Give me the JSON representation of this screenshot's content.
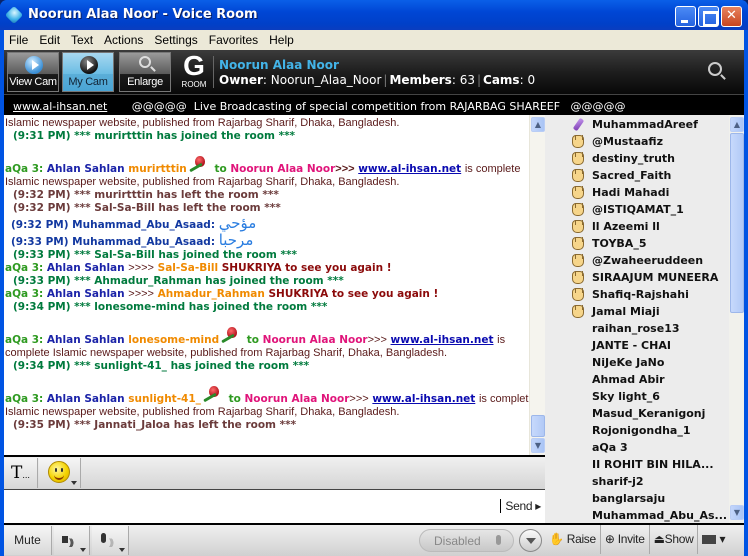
{
  "window": {
    "title": "Noorun Alaa Noor - Voice Room"
  },
  "menu": [
    "File",
    "Edit",
    "Text",
    "Actions",
    "Settings",
    "Favorites",
    "Help"
  ],
  "toolbar": {
    "view_cam": "View Cam",
    "my_cam": "My Cam",
    "enlarge": "Enlarge",
    "room_letter": "G",
    "room_label": "ROOM",
    "room_name": "Noorun Alaa Noor",
    "owner_label": "Owner",
    "owner": "Noorun_Alaa_Noor",
    "members_label": "Members",
    "members": "63",
    "cams_label": "Cams",
    "cams": "0"
  },
  "ticker": {
    "link": "www.al-ihsan.net",
    "text": "@@@@@  Live Broadcasting of special competition from RAJARBAG SHAREEF   @@@@@"
  },
  "chat": {
    "desc": "Islamic newspaper website, published from Rajarbag Sharif, Dhaka, Bangladesh.",
    "desc_wrap_a": "is",
    "desc_wrap_b": "complete Islamic newspaper website, published from Rajarbag Sharif, Dhaka, Bangladesh.",
    "is_complete": "is complete",
    "bot": "aQa 3:",
    "greet": "Ahlan Sahlan",
    "to": "to",
    "host": "Noorun Alaa Noor",
    "arrows": ">>>",
    "arrows4": ">>>>",
    "site": "www.al-ihsan.net",
    "shukriya": "SHUKRIYA to see you again !",
    "lines": {
      "l1": "(9:31 PM) *** murirtttin has joined the room ***",
      "u1": "murirtttin",
      "l2": "(9:32 PM) *** murirtttin has left the room ***",
      "l3": "(9:32 PM) *** Sal-Sa-Bill has left the room ***",
      "m1_head": "(9:32 PM) Muhammad_Abu_Asaad:",
      "m1_text": "مؤحي",
      "m2_head": "(9:33 PM) Muhammad_Abu_Asaad:",
      "m2_text": "مرحبا",
      "l4": "(9:33 PM) *** Sal-Sa-Bill has joined the room ***",
      "u2": "Sal-Sa-Bill",
      "l5": "(9:33 PM) *** Ahmadur_Rahman has joined the room ***",
      "u3": "Ahmadur_Rahman",
      "l6": "(9:34 PM) *** lonesome-mind has joined the room ***",
      "u4": "lonesome-mind",
      "l7": "(9:34 PM) *** sunlight-41_ has joined the room ***",
      "u5": "sunlight-41_",
      "l8": "(9:35 PM) *** Jannati_Jaloa has left the room ***"
    }
  },
  "users": [
    {
      "name": "MuhammadAreef",
      "icon": "mic"
    },
    {
      "name": "@Mustaafiz",
      "icon": "hand"
    },
    {
      "name": "destiny_truth",
      "icon": "hand"
    },
    {
      "name": "Sacred_Faith",
      "icon": "hand"
    },
    {
      "name": "Hadi Mahadi",
      "icon": "hand"
    },
    {
      "name": "@ISTIQAMAT_1",
      "icon": "hand"
    },
    {
      "name": "ll Azeemi ll",
      "icon": "hand"
    },
    {
      "name": "TOYBA_5",
      "icon": "hand"
    },
    {
      "name": "@Zwaheeruddeen",
      "icon": "hand"
    },
    {
      "name": "SIRAAJUM MUNEERA",
      "icon": "hand"
    },
    {
      "name": "Shafiq-Rajshahi",
      "icon": "hand"
    },
    {
      "name": "Jamal Miaji",
      "icon": "hand"
    },
    {
      "name": "raihan_rose13",
      "icon": ""
    },
    {
      "name": "JANTE - CHAI",
      "icon": ""
    },
    {
      "name": "NiJeKe JaNo",
      "icon": ""
    },
    {
      "name": "Ahmad Abir",
      "icon": ""
    },
    {
      "name": "Sky light_6",
      "icon": ""
    },
    {
      "name": "Masud_Keranigonj",
      "icon": ""
    },
    {
      "name": "Rojonigondha_1",
      "icon": ""
    },
    {
      "name": "aQa 3",
      "icon": ""
    },
    {
      "name": "II ROHIT BIN HILA...",
      "icon": ""
    },
    {
      "name": "sharif-j2",
      "icon": ""
    },
    {
      "name": "banglarsaju",
      "icon": ""
    },
    {
      "name": "Muhammad_Abu_As...",
      "icon": ""
    }
  ],
  "format": {
    "text_btn": "T",
    "text_btn_suffix": "..."
  },
  "input": {
    "value": "",
    "send": "Send ▸"
  },
  "audio": {
    "mute": "Mute",
    "talk": "Disabled"
  },
  "userbar": {
    "raise": "Raise",
    "invite": "Invite",
    "show": "Show"
  }
}
